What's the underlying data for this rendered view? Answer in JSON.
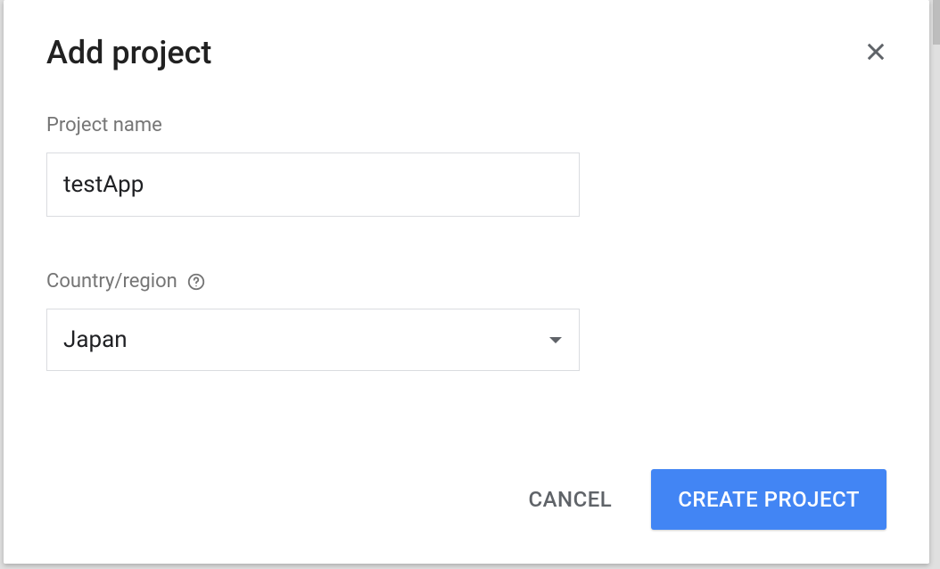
{
  "dialog": {
    "title": "Add project"
  },
  "form": {
    "project_name": {
      "label": "Project name",
      "value": "testApp"
    },
    "country_region": {
      "label": "Country/region",
      "value": "Japan"
    }
  },
  "actions": {
    "cancel": "CANCEL",
    "create": "CREATE PROJECT"
  }
}
